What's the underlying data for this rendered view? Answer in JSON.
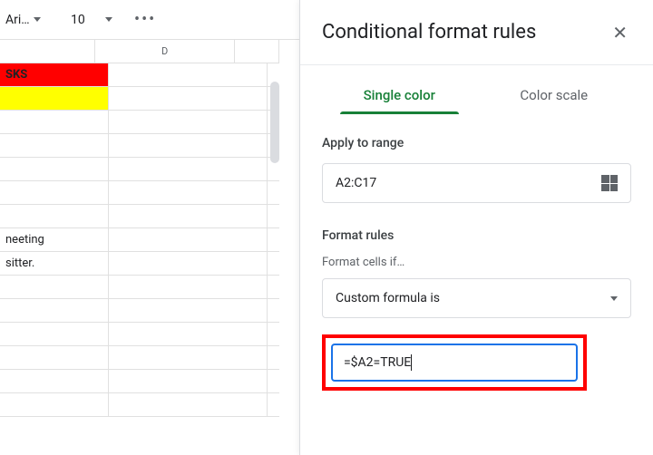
{
  "toolbar": {
    "font_name": "Ari…",
    "font_size": "10"
  },
  "spreadsheet": {
    "col_headers": {
      "d": "D"
    },
    "rows": {
      "r1_c": "SKS",
      "r8_c": "neeting",
      "r9_c": "sitter."
    }
  },
  "panel": {
    "title": "Conditional format rules",
    "tabs": {
      "single": "Single color",
      "scale": "Color scale"
    },
    "apply_range_label": "Apply to range",
    "range_value": "A2:C17",
    "format_rules_label": "Format rules",
    "format_cells_if": "Format cells if…",
    "condition_selected": "Custom formula is",
    "formula_value": "=$A2=TRUE"
  }
}
